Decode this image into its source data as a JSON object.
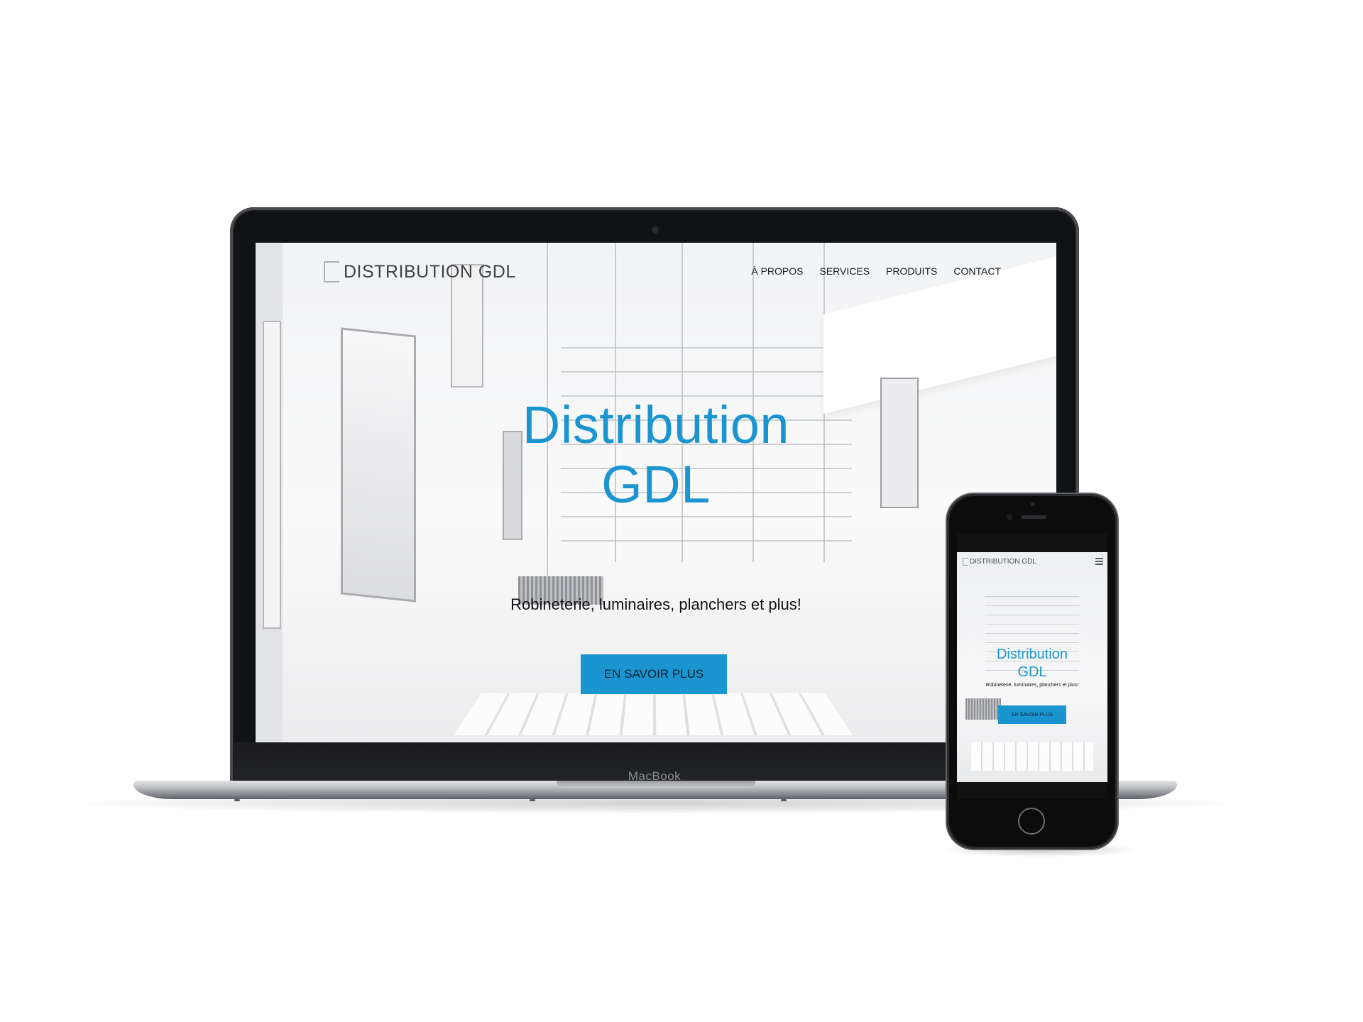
{
  "laptop": {
    "brand_label": "MacBook"
  },
  "site": {
    "logo_text": "DISTRIBUTION GDL",
    "nav": [
      {
        "label": "À PROPOS"
      },
      {
        "label": "SERVICES"
      },
      {
        "label": "PRODUITS"
      },
      {
        "label": "CONTACT"
      }
    ],
    "hero": {
      "title_line1": "Distribution",
      "title_line2": "GDL",
      "subtitle": "Robineterie, luminaires, planchers et plus!",
      "cta_label": "EN SAVOIR PLUS"
    },
    "colors": {
      "accent": "#1a95d0",
      "text": "#111214"
    }
  },
  "phone": {
    "logo_text": "DISTRIBUTION GDL",
    "menu_icon": "hamburger-icon",
    "hero": {
      "title_line1": "Distribution",
      "title_line2": "GDL",
      "subtitle": "Robineterie, luminaires, planchers et plus!",
      "cta_label": "EN SAVOIR PLUS"
    }
  }
}
